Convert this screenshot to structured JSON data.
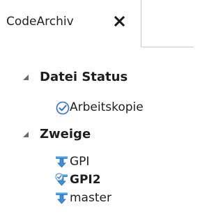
{
  "tab": {
    "label": "CodeArchiv",
    "close_icon": "close-icon"
  },
  "tree": {
    "sections": [
      {
        "label": "Datei Status",
        "expanded": true,
        "children": [
          {
            "label": "Arbeitskopie",
            "icon": "check-circle-icon",
            "bold": false
          }
        ]
      },
      {
        "label": "Zweige",
        "expanded": true,
        "children": [
          {
            "label": "GPI",
            "icon": "branch-icon",
            "bold": false
          },
          {
            "label": "GPI2",
            "icon": "branch-active-icon",
            "bold": true
          },
          {
            "label": "master",
            "icon": "branch-icon",
            "bold": false
          }
        ]
      }
    ]
  },
  "colors": {
    "check_blue": "#2f6fd6",
    "branch_blue": "#3c8fd8",
    "branch_light": "#8cc8f0",
    "check_active": "#5aa0e0"
  }
}
